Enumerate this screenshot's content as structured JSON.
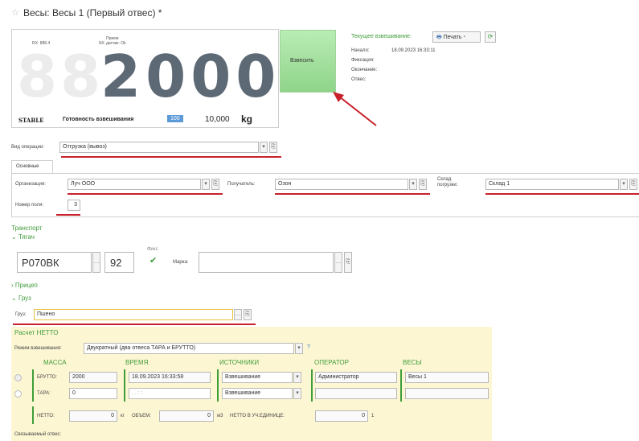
{
  "window": {
    "title": "Весы: Весы 1 (Первый отвес) *"
  },
  "scale_panel": {
    "label_rx": "RX: 888.4",
    "label_nx": "NX",
    "label_nx2": "Прием\nдатчик: Ok",
    "ghost_digits": "88",
    "digits": "2000",
    "stable": "STABLE",
    "ready_label": "Готовность взвешивания",
    "ready_value": "100",
    "capacity": "10,000",
    "unit": "kg"
  },
  "weigh_button": {
    "label": "Взвесить"
  },
  "current_weighing": {
    "header": "Текущее взвешивание:",
    "print_label": "Печать",
    "rows": [
      {
        "label": "Начало:",
        "value": "18.09.2023 16:33:11"
      },
      {
        "label": "Фиксация:",
        "value": ""
      },
      {
        "label": "Окончание:",
        "value": ""
      },
      {
        "label": "Отвес:",
        "value": ""
      }
    ]
  },
  "operation": {
    "label": "Вид операции:",
    "value": "Отгрузка (вывоз)"
  },
  "tabs": [
    {
      "label": "Основные"
    }
  ],
  "main": {
    "org_label": "Организация:",
    "org_value": "Луч ООО",
    "recipient_label": "Получатель:",
    "recipient_value": "Озон",
    "warehouse_label": "Склад\nпогрузки:",
    "warehouse_value": "Склад 1",
    "field_num_label": "Номер поля:",
    "field_num_value": "3"
  },
  "transport": {
    "header": "Транспорт",
    "tractor_header": "Тягач",
    "plate": "Р070ВК",
    "region": "92",
    "fix_label": "Фикс",
    "brand_label": "Марка:",
    "brand_value": "",
    "trailer_header": "Прицеп"
  },
  "cargo": {
    "header": "Груз",
    "label": "Груз:",
    "value": "Пшено"
  },
  "netto": {
    "header": "Расчет НЕТТО",
    "mode_label": "Режим взвешивания:",
    "mode_value": "Двукратный (два отвеса ТАРА и БРУТТО)",
    "help": "?",
    "col_mass": "МАССА",
    "col_time": "ВРЕМЯ",
    "col_sources": "ИСТОЧНИКИ",
    "col_operator": "ОПЕРАТОР",
    "col_scales": "ВЕСЫ",
    "brutto_label": "БРУТТО:",
    "brutto_value": "2000",
    "brutto_time": "18.09.2023 16:33:58",
    "brutto_source": "Взвешивание",
    "brutto_operator": "Администратор",
    "brutto_scales": "Весы 1",
    "tara_label": "ТАРА:",
    "tara_value": "0",
    "tara_time": ". .   : :",
    "tara_source": "Взвешивание",
    "netto_label": "НЕТТО:",
    "netto_value": "0",
    "netto_unit": "кг",
    "volume_label": "ОБЪЕМ:",
    "volume_value": "0",
    "volume_unit": "м3",
    "unit_label": "НЕТТО В УЧ.ЕДИНИЦЕ:",
    "unit_value": "0",
    "unit_suffix": "1"
  },
  "footer": {
    "label": "Связываемый отвес:"
  },
  "colors": {
    "accent_green": "#3f9d3a",
    "annotation_red": "#c8212b",
    "netto_bg": "#fdf6d3",
    "lcd_digit": "#5d6975"
  }
}
